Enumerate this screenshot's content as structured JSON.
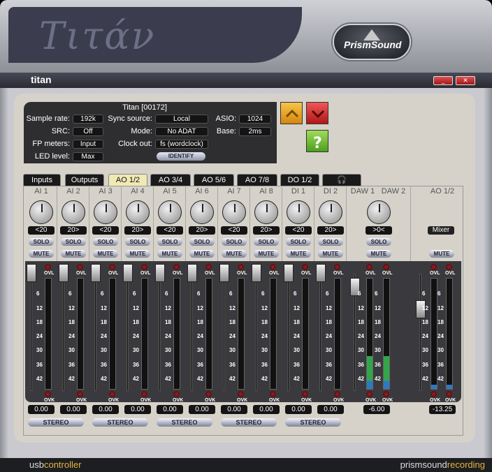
{
  "brand": {
    "name": "Τιτάν",
    "logo": "PrismSound"
  },
  "window": {
    "title": "titan",
    "min_label": "_",
    "close_label": "✕"
  },
  "device": {
    "name": "Titan [00172]"
  },
  "settings": {
    "sample_rate": {
      "label": "Sample rate:",
      "value": "192k"
    },
    "src": {
      "label": "SRC:",
      "value": "Off"
    },
    "fp_meters": {
      "label": "FP meters:",
      "value": "Input"
    },
    "led_level": {
      "label": "LED level:",
      "value": "Max"
    },
    "sync_source": {
      "label": "Sync source:",
      "value": "Local"
    },
    "mode": {
      "label": "Mode:",
      "value": "No ADAT"
    },
    "clock_out": {
      "label": "Clock out:",
      "value": "fs (wordclock)"
    },
    "asio": {
      "label": "ASIO:",
      "value": "1024"
    },
    "base": {
      "label": "Base:",
      "value": "2ms"
    },
    "identify": "IDENTIFY"
  },
  "tabs": [
    "Inputs",
    "Outputs",
    "AO 1/2",
    "AO 3/4",
    "AO 5/6",
    "AO 7/8",
    "DO 1/2",
    "🎧"
  ],
  "active_tab": "AO 1/2",
  "channels": [
    {
      "name": "AI 1",
      "pan": "<20",
      "gain": "0.00"
    },
    {
      "name": "AI 2",
      "pan": "20>",
      "gain": "0.00"
    },
    {
      "name": "AI 3",
      "pan": "<20",
      "gain": "0.00"
    },
    {
      "name": "AI 4",
      "pan": "20>",
      "gain": "0.00"
    },
    {
      "name": "AI 5",
      "pan": "<20",
      "gain": "0.00"
    },
    {
      "name": "AI 6",
      "pan": "20>",
      "gain": "0.00"
    },
    {
      "name": "AI 7",
      "pan": "<20",
      "gain": "0.00"
    },
    {
      "name": "AI 8",
      "pan": "20>",
      "gain": "0.00"
    },
    {
      "name": "DI 1",
      "pan": "<20",
      "gain": "0.00"
    },
    {
      "name": "DI 2",
      "pan": "20>",
      "gain": "0.00"
    }
  ],
  "daw": {
    "name1": "DAW 1",
    "name2": "DAW 2",
    "pan": ">0<",
    "gain": "-6.00",
    "level": 0.3
  },
  "out": {
    "name": "AO 1/2",
    "mixer": "Mixer",
    "gain": "-13.25",
    "level": 0.04
  },
  "buttons": {
    "solo": "SOLO",
    "mute": "MUTE",
    "stereo": "STEREO"
  },
  "meter_labels": {
    "ovl": "OVL",
    "ovk": "OVK",
    "scale": [
      "6",
      "12",
      "18",
      "24",
      "30",
      "36",
      "42"
    ]
  },
  "footer": {
    "left_a": "usb",
    "left_b": "controller",
    "right_a": "prismsound",
    "right_b": "recording"
  },
  "colors": {
    "active_tab": "#f1e9b4",
    "meter_green": "#33a64a",
    "meter_blue": "#2f78c6",
    "accent": "#e6b53a"
  }
}
